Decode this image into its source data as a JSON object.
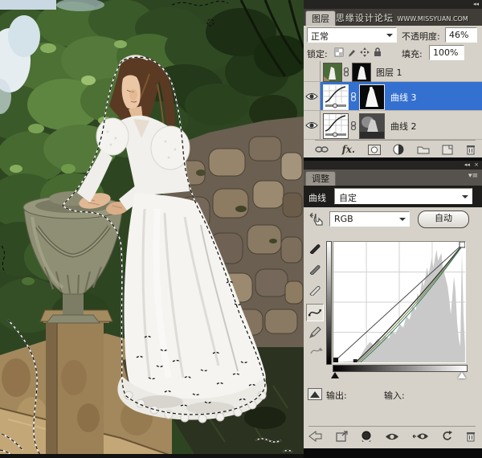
{
  "photo": {
    "description": "Bride in white gown leaning on a stone garden urn, hedges behind, stone wall below, active marching-ants selection around the figure",
    "selection_style": "marching-ants"
  },
  "watermark": {
    "site_name": "思缘设计论坛",
    "site_url": "WWW.MISSYUAN.COM"
  },
  "layers_panel": {
    "collapse_icon": "◂◂",
    "tab": "图层",
    "blend_mode": "正常",
    "opacity_label": "不透明度:",
    "opacity_value": "46%",
    "lock_label": "锁定:",
    "fill_label": "填充:",
    "fill_value": "100%",
    "fx_label": "fx.",
    "rows": [
      {
        "name": "图层 1",
        "visible": false,
        "selected": false,
        "type": "image-with-mask"
      },
      {
        "name": "曲线 3",
        "visible": true,
        "selected": true,
        "type": "curves-adjustment"
      },
      {
        "name": "曲线 2",
        "visible": true,
        "selected": false,
        "type": "curves-adjustment"
      }
    ]
  },
  "adjustments_panel": {
    "collapse_icon": "◂◂",
    "close_icon": "×",
    "tab": "调整",
    "panel_menu_icon": "▾≡",
    "curves_label": "曲线",
    "preset_value": "自定",
    "channel_value": "RGB",
    "auto_label": "自动",
    "output_label": "输出:",
    "input_label": "输入:"
  },
  "curve": {
    "type": "line",
    "channel": "RGB",
    "grid_divisions": 4,
    "baseline": [
      [
        0,
        0
      ],
      [
        255,
        255
      ]
    ],
    "composite_points": [
      [
        43,
        0
      ],
      [
        255,
        255
      ]
    ],
    "black_slider_input": 0,
    "white_slider_input": 255,
    "histogram": "right-weighted highlight peaks"
  },
  "colors": {
    "panel_bg": "#d6d2ca",
    "dark_bar": "#262422",
    "tab_bar": "#403d38",
    "selected_row": "#3470cf",
    "curve_strip_bg": "#1e1d1b",
    "histogram": "#c9c9c9",
    "ants": "#111111"
  }
}
